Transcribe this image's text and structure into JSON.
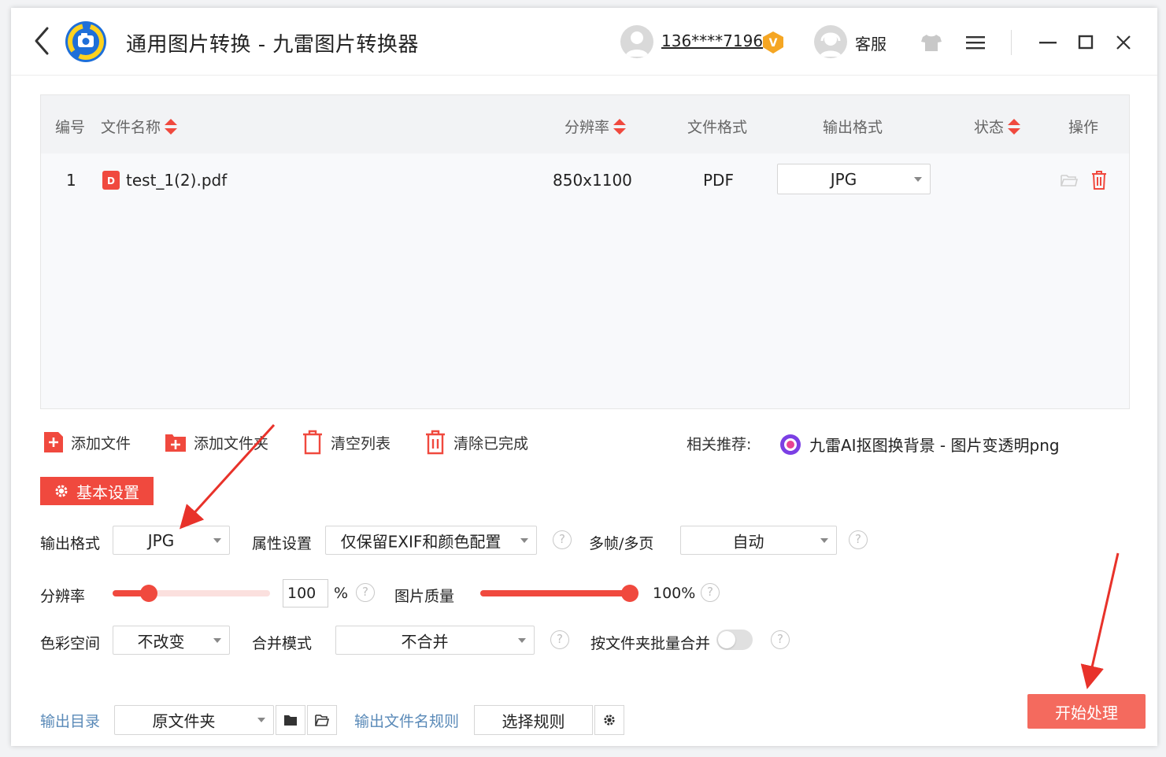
{
  "header": {
    "title": "通用图片转换 - 九雷图片转换器",
    "user_phone": "136****7196",
    "vip_badge": "V",
    "support_label": "客服"
  },
  "table": {
    "columns": {
      "index": "编号",
      "filename": "文件名称",
      "resolution": "分辨率",
      "file_format": "文件格式",
      "output_format": "输出格式",
      "status": "状态",
      "actions": "操作"
    },
    "rows": [
      {
        "index": "1",
        "filename": "test_1(2).pdf",
        "resolution": "850x1100",
        "file_format": "PDF",
        "output_format": "JPG",
        "file_icon_letter": "D"
      }
    ]
  },
  "toolbar": {
    "add_file": "添加文件",
    "add_folder": "添加文件夹",
    "clear_list": "清空列表",
    "clear_done": "清除已完成",
    "recommend_label": "相关推荐:",
    "recommend_link": "九雷AI抠图换背景 - 图片变透明png"
  },
  "settings": {
    "basic_settings": "基本设置",
    "output_format_label": "输出格式",
    "output_format_value": "JPG",
    "attr_label": "属性设置",
    "attr_value": "仅保留EXIF和颜色配置",
    "multiframe_label": "多帧/多页",
    "multiframe_value": "自动",
    "resolution_label": "分辨率",
    "resolution_value": "100",
    "resolution_fraction": 0.23,
    "percent_sign": "%",
    "quality_label": "图片质量",
    "quality_fraction": 1.0,
    "quality_value": "100%",
    "colorspace_label": "色彩空间",
    "colorspace_value": "不改变",
    "merge_label": "合并模式",
    "merge_value": "不合并",
    "folder_merge_label": "按文件夹批量合并",
    "folder_merge_on": false,
    "help_glyph": "?"
  },
  "footer": {
    "output_dir_label": "输出目录",
    "output_dir_value": "原文件夹",
    "filename_rule_label": "输出文件名规则",
    "select_rule": "选择规则",
    "start": "开始处理"
  },
  "colors": {
    "accent": "#f0493e",
    "start_button": "#f46a5e",
    "link_blue": "#5a8ab8"
  }
}
